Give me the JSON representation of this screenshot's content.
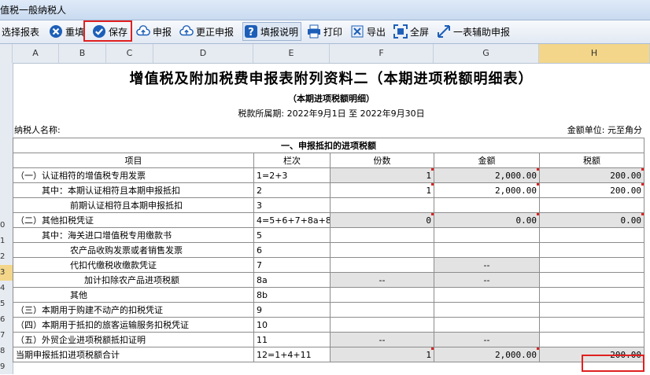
{
  "window": {
    "title": "值税一般纳税人"
  },
  "toolbar": {
    "select_report": "选择报表",
    "redo": "重填",
    "save": "保存",
    "declare": "申报",
    "correct_declare": "更正申报",
    "fill_help": "填报说明",
    "print": "打印",
    "export": "导出",
    "fullscreen": "全屏",
    "one_table_assist": "一表辅助申报"
  },
  "columns": [
    "A",
    "B",
    "C",
    "D",
    "E",
    "F",
    "G",
    "H"
  ],
  "row_numbers": [
    "",
    "",
    "",
    "",
    "",
    "",
    "",
    "",
    "",
    "",
    "0",
    "1",
    "2",
    "3",
    "4",
    "5",
    "6",
    "7",
    "8",
    "9"
  ],
  "report": {
    "title": "增值税及附加税费申报表附列资料二（本期进项税额明细表）",
    "subtitle": "（本期进项税额明细）",
    "period": "税款所属期:   2022年9月1日  至  2022年9月30日",
    "taxpayer_label": "纳税人名称:",
    "unit_label": "金额单位: 元至角分",
    "section_title": "一、申报抵扣的进项税额",
    "header": {
      "item": "项目",
      "column": "栏次",
      "count": "份数",
      "amount": "金额",
      "tax": "税额"
    },
    "rows": [
      {
        "item": "（一）认证相符的增值税专用发票",
        "col": "1=2+3",
        "count": "1",
        "amount": "2,000.00",
        "tax": "200.00"
      },
      {
        "item": "其中：本期认证相符且本期申报抵扣",
        "col": "2",
        "count": "1",
        "amount": "2,000.00",
        "tax": "200.00"
      },
      {
        "item": "前期认证相符且本期申报抵扣",
        "col": "3",
        "count": "",
        "amount": "",
        "tax": ""
      },
      {
        "item": "（二）其他扣税凭证",
        "col": "4=5+6+7+8a+8b",
        "count": "0",
        "amount": "0.00",
        "tax": "0.00"
      },
      {
        "item": "其中：海关进口增值税专用缴款书",
        "col": "5",
        "count": "",
        "amount": "",
        "tax": ""
      },
      {
        "item": "农产品收购发票或者销售发票",
        "col": "6",
        "count": "",
        "amount": "",
        "tax": ""
      },
      {
        "item": "代扣代缴税收缴款凭证",
        "col": "7",
        "count": "",
        "amount": "--",
        "tax": ""
      },
      {
        "item": "加计扣除农产品进项税额",
        "col": "8a",
        "count": "--",
        "amount": "--",
        "tax": ""
      },
      {
        "item": "其他",
        "col": "8b",
        "count": "",
        "amount": "",
        "tax": ""
      },
      {
        "item": "（三）本期用于购建不动产的扣税凭证",
        "col": "9",
        "count": "",
        "amount": "",
        "tax": ""
      },
      {
        "item": "（四）本期用于抵扣的旅客运输服务扣税凭证",
        "col": "10",
        "count": "",
        "amount": "",
        "tax": ""
      },
      {
        "item": "（五）外贸企业进项税额抵扣证明",
        "col": "11",
        "count": "--",
        "amount": "--",
        "tax": ""
      },
      {
        "item": "当期申报抵扣进项税额合计",
        "col": "12=1+4+11",
        "count": "1",
        "amount": "2,000.00",
        "tax": "200.00"
      }
    ]
  },
  "colors": {
    "highlight": "#e02020",
    "gray_cell": "#e3e3e3",
    "icon_blue": "#1d5fb8"
  }
}
